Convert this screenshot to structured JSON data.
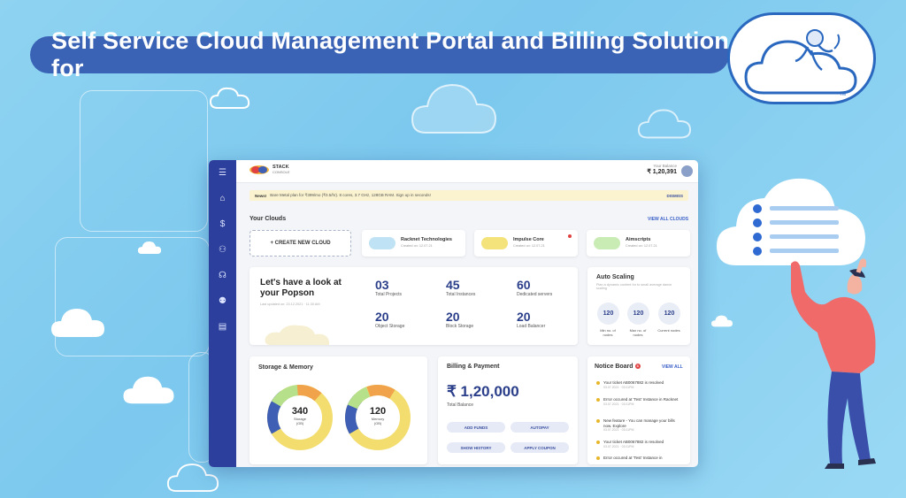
{
  "banner": {
    "title": "Self Service Cloud Management Portal and Billing Solution for"
  },
  "app": {
    "brand": {
      "name": "STACK",
      "sub": "CONSOLE"
    },
    "balance": {
      "label": "Your Balance",
      "value": "₹ 1,20,391"
    },
    "news": {
      "tag": "News!",
      "text": "Bare Metal plan for ₹399/mo (₹0.5/hr). 8 cores, 3.7 GHz, 128GB RAM. Sign up in seconds!",
      "dismiss": "DISMISS"
    },
    "clouds": {
      "title": "Your Clouds",
      "view_all": "VIEW ALL CLOUDS",
      "create": "+ CREATE NEW CLOUD",
      "items": [
        {
          "name": "Racknet Technologies",
          "sub": "Created on: 12.07.21",
          "color": "#bfe3f5"
        },
        {
          "name": "Impulse Core",
          "sub": "Created on: 12.07.21",
          "color": "#f3e37a"
        },
        {
          "name": "Aimscripts",
          "sub": "Created on: 12.07.21",
          "color": "#c9ecb5"
        }
      ]
    },
    "overview": {
      "heading": "Let's have a look at your Popson",
      "sub": "Last updated on: 23.12.2021 · 11:30 AM",
      "stats": [
        {
          "value": "03",
          "label": "Total Projects"
        },
        {
          "value": "45",
          "label": "Total Instances"
        },
        {
          "value": "60",
          "label": "Dedicated servers"
        },
        {
          "value": "20",
          "label": "Object Storage"
        },
        {
          "value": "20",
          "label": "Block Storage"
        },
        {
          "value": "20",
          "label": "Load Balancer"
        }
      ]
    },
    "autoscaling": {
      "title": "Auto Scaling",
      "desc": "Plan a dynamic content for to small average dance scaling",
      "items": [
        {
          "value": "120",
          "label": "Min no. of nodes"
        },
        {
          "value": "120",
          "label": "Max no. of nodes"
        },
        {
          "value": "120",
          "label": "Current nodes"
        }
      ]
    },
    "storage": {
      "title": "Storage & Memory",
      "donuts": [
        {
          "value": "340",
          "label": "Storage",
          "unit": "(GB)"
        },
        {
          "value": "120",
          "label": "Memory",
          "unit": "(GB)"
        }
      ]
    },
    "billing": {
      "title": "Billing & Payment",
      "amount": "₹ 1,20,000",
      "label": "Total Balance",
      "buttons": [
        "ADD FUNDS",
        "AUTOPAY",
        "SHOW HISTORY",
        "APPLY COUPON"
      ]
    },
    "notices": {
      "title": "Notice Board",
      "count": "3",
      "view_all": "VIEW ALL",
      "items": [
        {
          "text": "Your ticket AB0067882 is resolved",
          "date": "03.07.2021 · 03:11PM"
        },
        {
          "text": "Error occured at 'Test' Instance in Racknet",
          "date": "03.07.2021 · 03:11PM"
        },
        {
          "text": "New feature - You can manage your bills now. Explore",
          "date": "03.07.2021 · 03:11PM"
        },
        {
          "text": "Your ticket AB0067882 is resolved",
          "date": "03.07.2021 · 03:11PM"
        },
        {
          "text": "Error occured at 'Test' Instance in",
          "date": ""
        }
      ]
    }
  },
  "colors": {
    "accent": "#2c3f9c",
    "banner": "#3a63b6",
    "donut_yellow": "#f2dd6e",
    "donut_blue": "#3f5fb5",
    "donut_green": "#b7e08a",
    "donut_orange": "#f0a34a"
  }
}
